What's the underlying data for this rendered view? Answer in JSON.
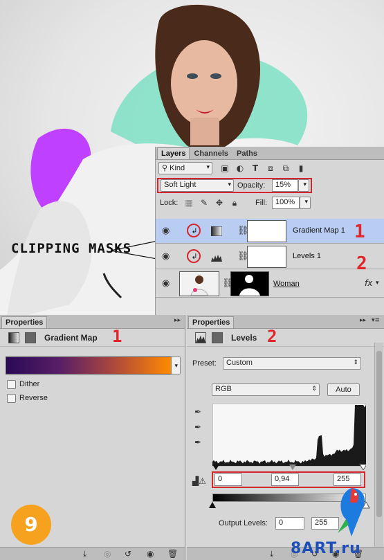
{
  "annotations": {
    "clipping_masks_label": "CLIPPING MASKS",
    "num_1": "1",
    "num_2": "2",
    "step_badge": "9",
    "watermark": "8ART.ru"
  },
  "layers_panel": {
    "tabs": [
      "Layers",
      "Channels",
      "Paths"
    ],
    "filter_kind": "Kind",
    "blend_mode": "Soft Light",
    "opacity_label": "Opacity:",
    "opacity_value": "15%",
    "lock_label": "Lock:",
    "fill_label": "Fill:",
    "fill_value": "100%",
    "layers": [
      {
        "name": "Gradient Map 1",
        "selected": true
      },
      {
        "name": "Levels 1",
        "selected": false
      },
      {
        "name": "Woman",
        "selected": false
      }
    ],
    "fx_label": "fx"
  },
  "properties_left": {
    "tab": "Properties",
    "title": "Gradient Map",
    "dither_label": "Dither",
    "reverse_label": "Reverse",
    "gradient_colors": [
      "#2a0a55",
      "#5a1f66",
      "#b04a3a",
      "#ff8a00"
    ]
  },
  "properties_right": {
    "tab": "Properties",
    "title": "Levels",
    "preset_label": "Preset:",
    "preset_value": "Custom",
    "channel_value": "RGB",
    "auto_label": "Auto",
    "input_black": "0",
    "input_gamma": "0,94",
    "input_white": "255",
    "output_label": "Output Levels:",
    "output_black": "0",
    "output_white": "255"
  },
  "colors": {
    "accent_red": "#d6262d",
    "selection": "#b9cdf3",
    "panel": "#d6d6d6",
    "badge": "#f6a21e"
  }
}
